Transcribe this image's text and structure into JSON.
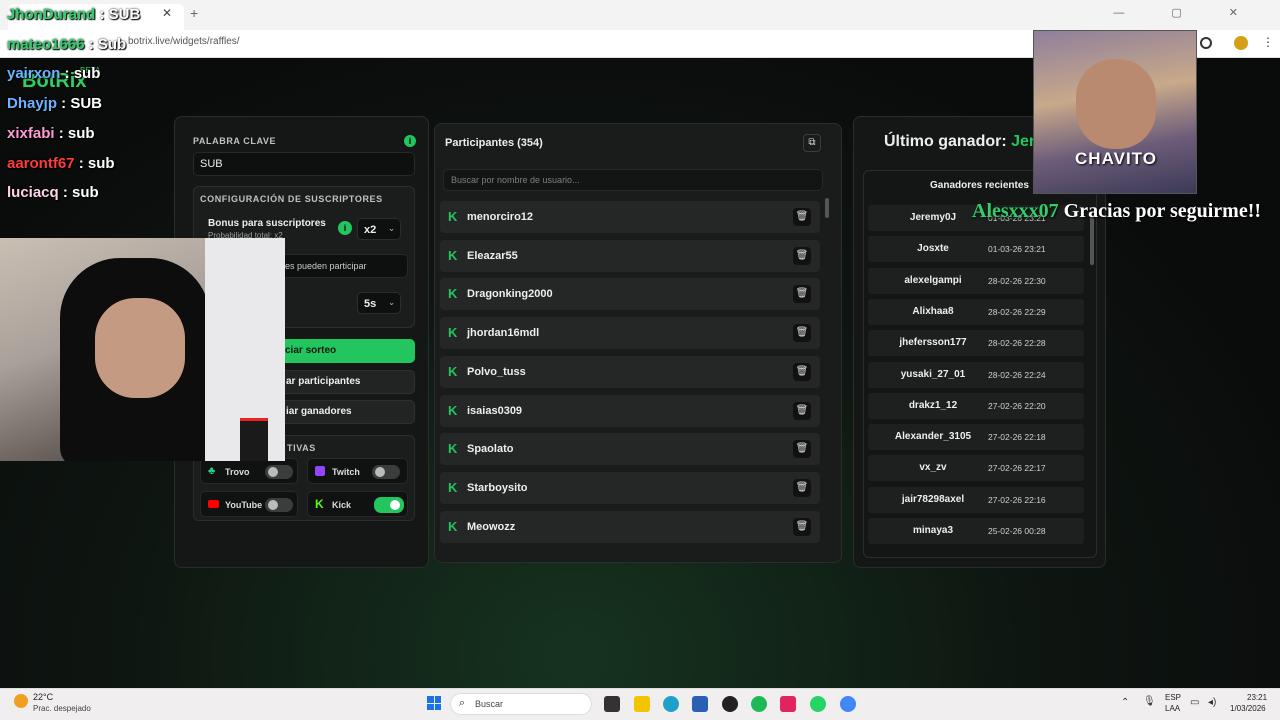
{
  "browser": {
    "url": "botrix.live/widgets/raffles/",
    "win_controls": "— ▢ ✕"
  },
  "app": {
    "logo": "BotRix",
    "beta": "BETA"
  },
  "left": {
    "keyword_label": "PALABRA CLAVE",
    "keyword_value": "SUB",
    "sub_config_label": "CONFIGURACIÓN DE SUSCRIPTORES",
    "bonus_label": "Bonus para suscriptores",
    "bonus_prob": "Probabilidad total: x2",
    "bonus_value": "x2",
    "subs_only_text": "es pueden participar",
    "timer_value": "5s",
    "start_btn": "ciar sorteo",
    "participants_btn": "ar participantes",
    "winners_btn": "iar ganadores",
    "platforms_label": "TIVAS",
    "platforms": [
      {
        "name": "Trovo",
        "on": false,
        "color": "#1fd28a"
      },
      {
        "name": "Twitch",
        "on": false,
        "color": "#9146ff"
      },
      {
        "name": "YouTube",
        "on": false,
        "color": "#ff0000"
      },
      {
        "name": "Kick",
        "on": true,
        "color": "#53fc18"
      }
    ]
  },
  "middle": {
    "title": "Participantes (354)",
    "search_placeholder": "Buscar por nombre de usuario...",
    "participants": [
      "menorciro12",
      "Eleazar55",
      "Dragonking2000",
      "jhordan16mdl",
      "Polvo_tuss",
      "isaias0309",
      "Spaolato",
      "Starboysito",
      "Meowozz"
    ]
  },
  "right": {
    "last_winner_label": "Último ganador: ",
    "last_winner_partial": "Jere",
    "recent_label": "Ganadores recientes",
    "winners": [
      {
        "name": "Jeremy0J",
        "date": "01-03-26 23:21"
      },
      {
        "name": "Josxte",
        "date": "01-03-26 23:21"
      },
      {
        "name": "alexelgampi",
        "date": "28-02-26 22:30"
      },
      {
        "name": "Alixhaa8",
        "date": "28-02-26 22:29"
      },
      {
        "name": "jhefersson177",
        "date": "28-02-26 22:28"
      },
      {
        "name": "yusaki_27_01",
        "date": "28-02-26 22:24"
      },
      {
        "name": "drakz1_12",
        "date": "27-02-26 22:20"
      },
      {
        "name": "Alexander_3105",
        "date": "27-02-26 22:18"
      },
      {
        "name": "vx_zv",
        "date": "27-02-26 22:17"
      },
      {
        "name": "jair78298axel",
        "date": "27-02-26 22:16"
      },
      {
        "name": "minaya3",
        "date": "25-02-26 00:28"
      }
    ]
  },
  "chat": [
    {
      "user": "JhonDurand",
      "msg": " : SUB",
      "color": "#2fd06b"
    },
    {
      "user": "mateo1666",
      "msg": " : Sub",
      "color": "#2fd06b"
    },
    {
      "user": "yairxon",
      "msg": " : sub",
      "color": "#6db3ff"
    },
    {
      "user": "Dhayjp",
      "msg": " : SUB",
      "color": "#6db3ff"
    },
    {
      "user": "xixfabi",
      "msg": " : sub",
      "color": "#ff9ad6"
    },
    {
      "user": "aarontf67",
      "msg": " : sub",
      "color": "#ff3b3b"
    },
    {
      "user": "luciacq",
      "msg": " : sub",
      "color": "#ffd3e8"
    }
  ],
  "overlay": {
    "chavito": "CHAVITO",
    "follow_user": "Alesxxx07",
    "follow_msg": " Gracias por seguirme!!"
  },
  "taskbar": {
    "temp": "22°C",
    "weather": "Prac. despejado",
    "search": "Buscar",
    "lang1": "ESP",
    "lang2": "LAA",
    "time": "23:21",
    "date": "1/03/2026"
  }
}
